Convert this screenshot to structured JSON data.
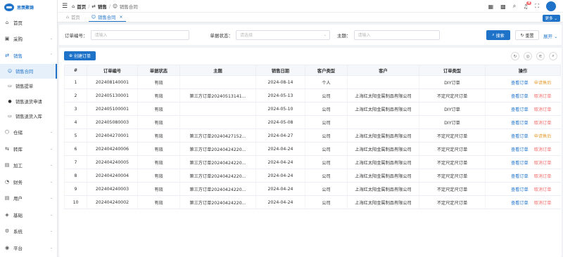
{
  "brand": {
    "name": "思羡聚铸"
  },
  "sidebar": {
    "items": [
      {
        "label": "首页",
        "icon": "home-icon",
        "glyph": "⌂",
        "arrow": ""
      },
      {
        "label": "采购",
        "icon": "briefcase-icon",
        "glyph": "▣",
        "arrow": "⌄"
      },
      {
        "label": "销售",
        "icon": "sales-icon",
        "glyph": "⇄",
        "arrow": "⌃"
      },
      {
        "label": "仓储",
        "icon": "warehouse-icon",
        "glyph": "⬡",
        "arrow": "⌄"
      },
      {
        "label": "转库",
        "icon": "transfer-icon",
        "glyph": "⇆",
        "arrow": "⌄"
      },
      {
        "label": "加工",
        "icon": "process-icon",
        "glyph": "▤",
        "arrow": "⌄"
      },
      {
        "label": "财务",
        "icon": "finance-icon",
        "glyph": "◔",
        "arrow": "⌄"
      },
      {
        "label": "用户",
        "icon": "user-icon",
        "glyph": "▤",
        "arrow": "⌄"
      },
      {
        "label": "基础",
        "icon": "base-icon",
        "glyph": "◈",
        "arrow": "⌄"
      },
      {
        "label": "系统",
        "icon": "gear-icon",
        "glyph": "⚙",
        "arrow": "⌄"
      },
      {
        "label": "平台",
        "icon": "platform-icon",
        "glyph": "◉",
        "arrow": "⌄"
      }
    ],
    "sales_sub": [
      {
        "label": "销售合同",
        "icon": "contract-icon",
        "glyph": "☺"
      },
      {
        "label": "销售提单",
        "icon": "bill-icon",
        "glyph": "▭"
      },
      {
        "label": "销售退货申请",
        "icon": "return-apply-icon",
        "glyph": "●"
      },
      {
        "label": "销售退货入库",
        "icon": "return-stock-icon",
        "glyph": "▭"
      }
    ]
  },
  "topbar": {
    "breadcrumb": [
      "首页",
      "销售",
      "销售合同"
    ],
    "notification_count": "8"
  },
  "tabs": [
    {
      "label": "首页"
    },
    {
      "label": "销售合同"
    }
  ],
  "more_label": "更多",
  "filter": {
    "order_no_label": "订单编号：",
    "order_no_placeholder": "请输入",
    "status_label": "单据状态：",
    "status_placeholder": "请选择",
    "subject_label": "主题：",
    "subject_placeholder": "请输入",
    "search_label": "搜索",
    "reset_label": "重置",
    "expand_label": "展开"
  },
  "create_label": "创建订单",
  "table": {
    "headers": [
      "#",
      "订单编号",
      "单据状态",
      "主题",
      "销售日期",
      "客户类型",
      "客户",
      "订单类型",
      "操作"
    ],
    "rows": [
      {
        "no": "1",
        "order": "202408140001",
        "status": "有效",
        "subject": "",
        "date": "2024-08-14",
        "ctype": "个人",
        "customer": "",
        "otype": "DIY订单",
        "op1": "查看订单",
        "op2": "申请售后",
        "op2_kind": "warn"
      },
      {
        "no": "2",
        "order": "202405130001",
        "status": "有效",
        "subject": "第三方订单20240513141...",
        "date": "2024-05-13",
        "ctype": "公司",
        "customer": "上海红太阳金属制品有限公司",
        "otype": "不定尺定尺订单",
        "op1": "查看订单",
        "op2": "取消订单",
        "op2_kind": "red"
      },
      {
        "no": "3",
        "order": "202405100001",
        "status": "有效",
        "subject": "",
        "date": "2024-05-10",
        "ctype": "公司",
        "customer": "上海红太阳金属制品有限公司",
        "otype": "DIY订单",
        "op1": "查看订单",
        "op2": "取消订单",
        "op2_kind": "red"
      },
      {
        "no": "4",
        "order": "202405080003",
        "status": "有效",
        "subject": "",
        "date": "2024-05-08",
        "ctype": "公司",
        "customer": "",
        "otype": "DIY订单",
        "op1": "查看订单",
        "op2": "取消订单",
        "op2_kind": "red"
      },
      {
        "no": "5",
        "order": "202404270001",
        "status": "有效",
        "subject": "第三方订单20240427152...",
        "date": "2024-04-27",
        "ctype": "公司",
        "customer": "上海红太阳金属制品有限公司",
        "otype": "不定尺定尺订单",
        "op1": "查看订单",
        "op2": "申请售后",
        "op2_kind": "warn"
      },
      {
        "no": "6",
        "order": "202404240006",
        "status": "有效",
        "subject": "第三方订单20240424220...",
        "date": "2024-04-24",
        "ctype": "公司",
        "customer": "上海红太阳金属制品有限公司",
        "otype": "不定尺定尺订单",
        "op1": "查看订单",
        "op2": "取消订单",
        "op2_kind": "red"
      },
      {
        "no": "7",
        "order": "202404240005",
        "status": "有效",
        "subject": "第三方订单20240424220...",
        "date": "2024-04-24",
        "ctype": "公司",
        "customer": "上海红太阳金属制品有限公司",
        "otype": "不定尺定尺订单",
        "op1": "查看订单",
        "op2": "取消订单",
        "op2_kind": "red"
      },
      {
        "no": "8",
        "order": "202404240004",
        "status": "有效",
        "subject": "第三方订单20240424220...",
        "date": "2024-04-24",
        "ctype": "公司",
        "customer": "上海红太阳金属制品有限公司",
        "otype": "不定尺定尺订单",
        "op1": "查看订单",
        "op2": "取消订单",
        "op2_kind": "red"
      },
      {
        "no": "9",
        "order": "202404240003",
        "status": "有效",
        "subject": "第三方订单20240424220...",
        "date": "2024-04-24",
        "ctype": "公司",
        "customer": "上海红太阳金属制品有限公司",
        "otype": "不定尺定尺订单",
        "op1": "查看订单",
        "op2": "取消订单",
        "op2_kind": "red"
      },
      {
        "no": "10",
        "order": "202404240002",
        "status": "有效",
        "subject": "第三方订单20240424220...",
        "date": "2024-04-24",
        "ctype": "公司",
        "customer": "上海红太阳金属制品有限公司",
        "otype": "不定尺定尺订单",
        "op1": "查看订单",
        "op2": "取消订单",
        "op2_kind": "red"
      }
    ]
  },
  "colors": {
    "primary": "#1e73c9",
    "warn": "#e6a23c",
    "danger": "#f56c6c"
  }
}
